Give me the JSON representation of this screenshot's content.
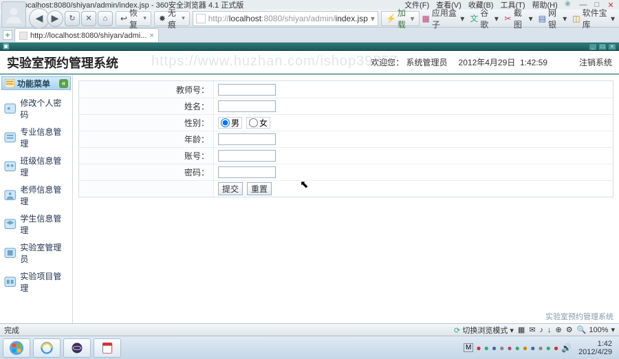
{
  "browser": {
    "title": "http://localhost:8080/shiyan/admin/index.jsp - 360安全浏览器 4.1 正式版",
    "menus": [
      "文件(F)",
      "查看(V)",
      "收藏(B)",
      "工具(T)",
      "帮助(H)"
    ],
    "restore_label": "恢复",
    "wudu_label": "无痕",
    "url_gray_prefix": "http://",
    "url_host": "localhost",
    "url_gray_mid": ":8080/shiyan/admin/",
    "url_page": "index.jsp",
    "go_label": "加载",
    "links": [
      "应用盒子",
      "谷歌",
      "截图",
      "网银",
      "软件宝库"
    ],
    "tab_label": "http://localhost:8080/shiyan/admi...",
    "inner_title": "",
    "status_done": "完成",
    "status_mode": "切换浏览模式",
    "zoom": "100%"
  },
  "app": {
    "title": "实验室预约管理系统",
    "watermark": "https://www.huzhan.com/ishop39357",
    "welcome_prefix": "欢迎您：",
    "welcome_user": "系统管理员",
    "date": "2012年4月29日",
    "time": "1:42:59",
    "logout": "注销系统",
    "side_title": "功能菜单",
    "side_sub": "",
    "side_items": [
      {
        "label": "修改个人密码"
      },
      {
        "label": "专业信息管理"
      },
      {
        "label": "班级信息管理"
      },
      {
        "label": "老师信息管理"
      },
      {
        "label": "学生信息管理"
      },
      {
        "label": "实验室管理员"
      },
      {
        "label": "实验项目管理"
      }
    ],
    "form": {
      "teacher_no": "教师号：",
      "name": "姓名：",
      "gender": "性别：",
      "gender_m": "男",
      "gender_f": "女",
      "age": "年龄：",
      "account": "账号：",
      "password": "密码：",
      "submit": "提交",
      "reset": "重置"
    },
    "branding": "实验室预约管理系统"
  },
  "taskbar": {
    "clock_time": "1:42",
    "clock_date": "2012/4/29"
  },
  "colors": {
    "teal": "#2e7a7a",
    "side_grad_a": "#d2ebff",
    "side_grad_b": "#a9d3ef"
  }
}
